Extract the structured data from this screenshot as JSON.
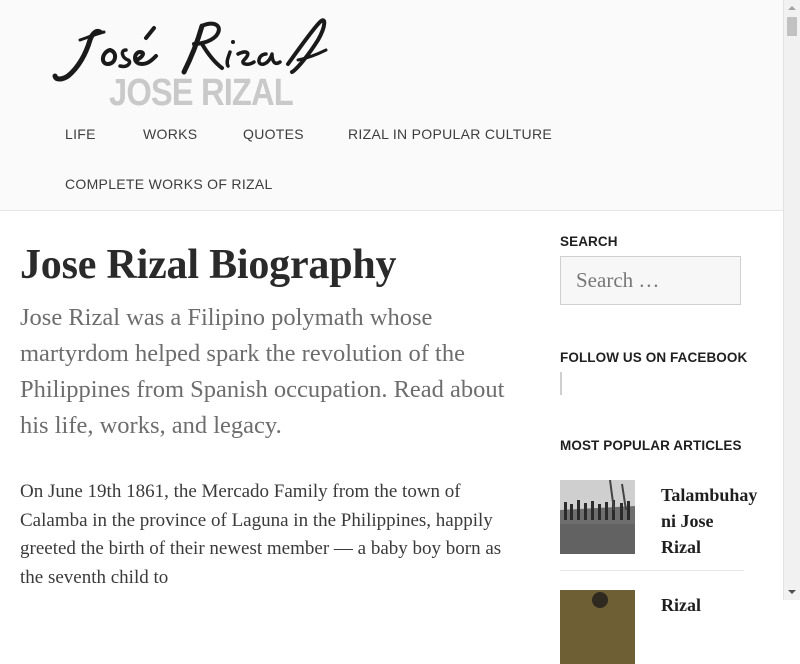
{
  "header": {
    "logo_text": "JOSE RIZAL",
    "logo_signature": "José Rizal",
    "nav": [
      {
        "label": "LIFE"
      },
      {
        "label": "WORKS"
      },
      {
        "label": "QUOTES"
      },
      {
        "label": "RIZAL IN POPULAR CULTURE"
      },
      {
        "label": "COMPLETE WORKS OF RIZAL"
      }
    ]
  },
  "main": {
    "title": "Jose Rizal Biography",
    "lead": "Jose Rizal was a Filipino polymath whose martyrdom helped spark the revolution of the Philippines from Spanish occupation. Read about his life, works, and legacy.",
    "body": "On June 19th 1861, the Mercado Family from the town of Calamba in the province of Laguna in the Philippines, happily greeted the birth of their newest member — a baby boy born as the seventh child to"
  },
  "sidebar": {
    "search": {
      "title": "SEARCH",
      "placeholder": "Search …"
    },
    "facebook": {
      "title": "FOLLOW US ON FACEBOOK"
    },
    "popular": {
      "title": "MOST POPULAR ARTICLES",
      "articles": [
        {
          "title": "Talambuhay ni Jose Rizal"
        },
        {
          "title": "Rizal"
        }
      ]
    }
  },
  "colors": {
    "header_bg": "#fafafa",
    "logo_gray": "#c9c9c9",
    "text_dark": "#2a2a2a",
    "text_muted": "#6d6d6d"
  },
  "icons": [
    "scroll-up-arrow-icon",
    "scroll-down-arrow-icon"
  ]
}
